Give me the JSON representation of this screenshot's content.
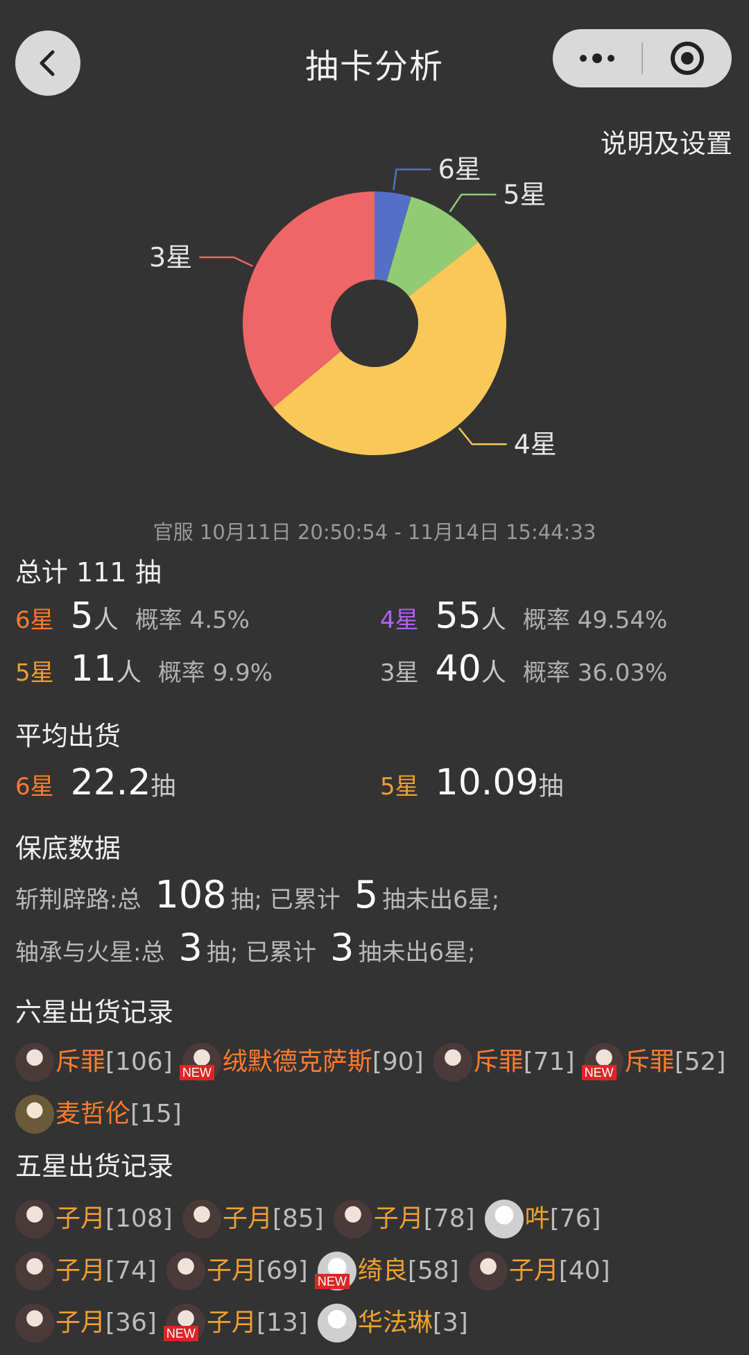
{
  "nav": {
    "title": "抽卡分析",
    "settings_link": "说明及设置"
  },
  "chart_data": {
    "type": "pie",
    "categories": [
      "6星",
      "5星",
      "4星",
      "3星"
    ],
    "values": [
      5,
      11,
      55,
      40
    ],
    "colors": [
      "#5470c6",
      "#91cc75",
      "#fac858",
      "#ee6666"
    ],
    "donut": true,
    "labels_outside": true
  },
  "timerange": "官服  10月11日 20:50:54  -  11月14日 15:44:33",
  "total": "总计 111 抽",
  "stats": [
    {
      "star": "6星",
      "count": "5",
      "unit": "人",
      "rate": "概率 4.5%",
      "cls": "c6"
    },
    {
      "star": "4星",
      "count": "55",
      "unit": "人",
      "rate": "概率 49.54%",
      "cls": "c4"
    },
    {
      "star": "5星",
      "count": "11",
      "unit": "人",
      "rate": "概率 9.9%",
      "cls": "c5"
    },
    {
      "star": "3星",
      "count": "40",
      "unit": "人",
      "rate": "概率 36.03%",
      "cls": "c3"
    }
  ],
  "avg": {
    "title": "平均出货",
    "items": [
      {
        "star": "6星",
        "value": "22.2",
        "unit": "抽"
      },
      {
        "star": "5星",
        "value": "10.09",
        "unit": "抽"
      }
    ]
  },
  "guarantee": {
    "title": "保底数据",
    "rows": [
      {
        "pool": "斩荆辟路:总",
        "total": "108",
        "mid": "抽;  已累计",
        "acc": "5",
        "tail": "抽未出6星;"
      },
      {
        "pool": "轴承与火星:总",
        "total": "3",
        "mid": "抽;  已累计",
        "acc": "3",
        "tail": "抽未出6星;"
      }
    ]
  },
  "six_star": {
    "title": "六星出货记录",
    "records": [
      {
        "name": "斥罪",
        "count": "[106]",
        "new": false,
        "avatar": "dark"
      },
      {
        "name": "绒默德克萨斯",
        "count": "[90]",
        "new": true,
        "avatar": "dark"
      },
      {
        "name": "斥罪",
        "count": "[71]",
        "new": false,
        "avatar": "dark"
      },
      {
        "name": "斥罪",
        "count": "[52]",
        "new": true,
        "avatar": "dark"
      },
      {
        "name": "麦哲伦",
        "count": "[15]",
        "new": false,
        "avatar": "blond"
      }
    ]
  },
  "five_star": {
    "title": "五星出货记录",
    "records": [
      {
        "name": "子月",
        "count": "[108]",
        "new": false,
        "avatar": "dark"
      },
      {
        "name": "子月",
        "count": "[85]",
        "new": false,
        "avatar": "dark"
      },
      {
        "name": "子月",
        "count": "[78]",
        "new": false,
        "avatar": "dark"
      },
      {
        "name": "吽",
        "count": "[76]",
        "new": false,
        "avatar": "light"
      },
      {
        "name": "子月",
        "count": "[74]",
        "new": false,
        "avatar": "dark"
      },
      {
        "name": "子月",
        "count": "[69]",
        "new": false,
        "avatar": "dark"
      },
      {
        "name": "绮良",
        "count": "[58]",
        "new": true,
        "avatar": "light"
      },
      {
        "name": "子月",
        "count": "[40]",
        "new": false,
        "avatar": "dark"
      },
      {
        "name": "子月",
        "count": "[36]",
        "new": false,
        "avatar": "dark"
      },
      {
        "name": "子月",
        "count": "[13]",
        "new": true,
        "avatar": "dark"
      },
      {
        "name": "华法琳",
        "count": "[3]",
        "new": false,
        "avatar": "light"
      }
    ]
  },
  "new_badge": "NEW"
}
